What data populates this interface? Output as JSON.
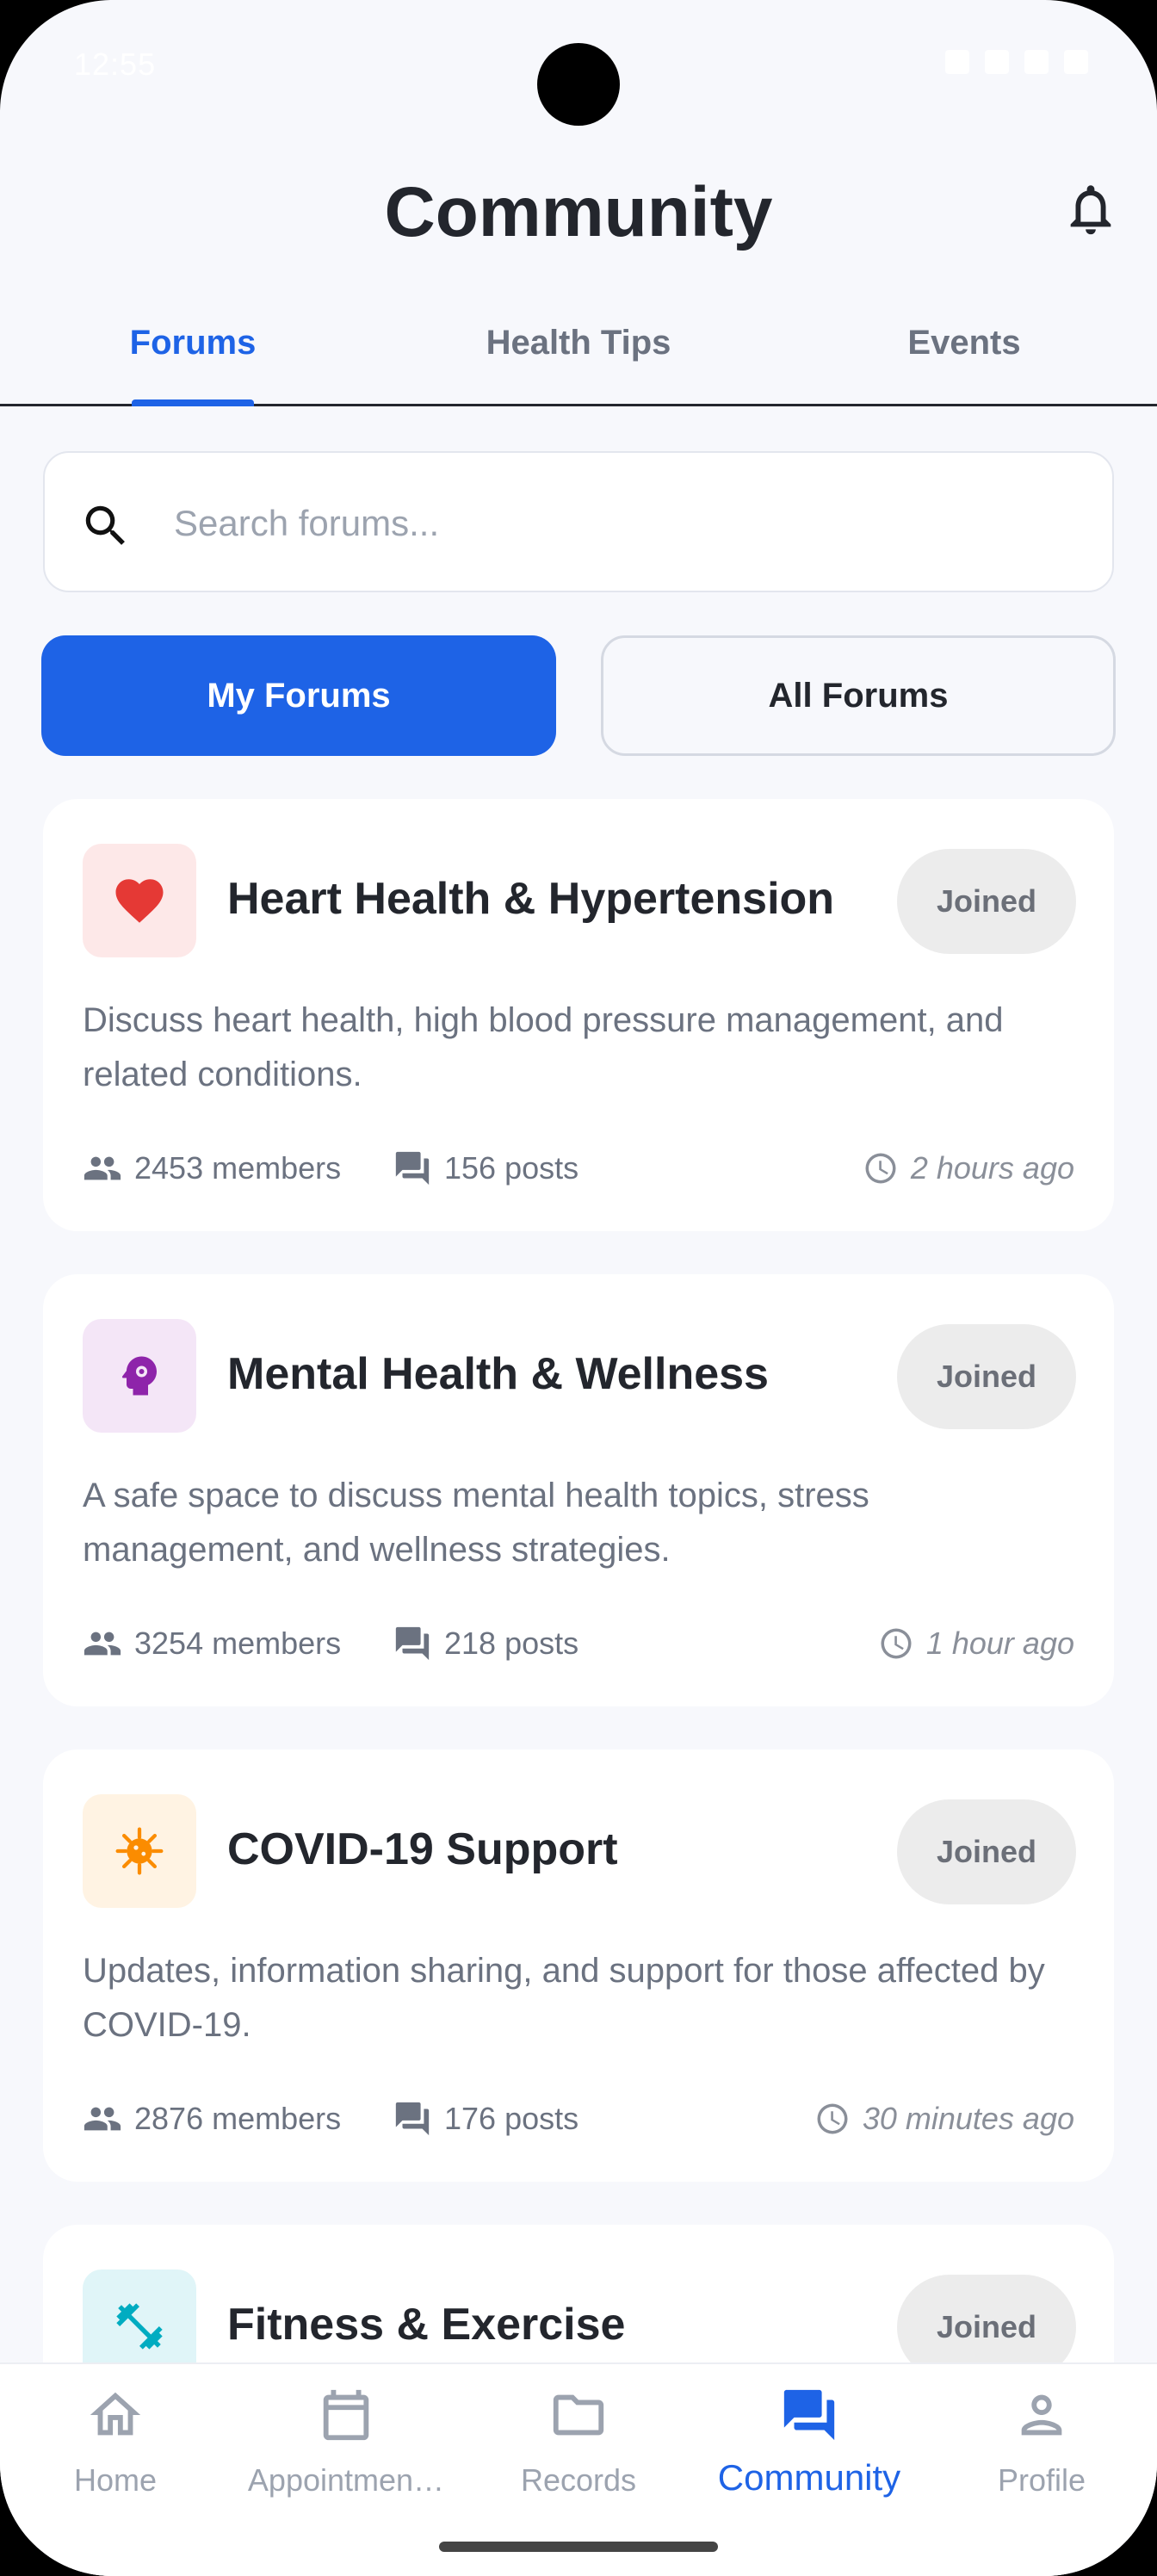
{
  "status_bar": {
    "time": "12:55"
  },
  "header": {
    "title": "Community"
  },
  "tabs": [
    {
      "label": "Forums",
      "active": true
    },
    {
      "label": "Health Tips",
      "active": false
    },
    {
      "label": "Events",
      "active": false
    }
  ],
  "search": {
    "placeholder": "Search forums..."
  },
  "segments": {
    "my_forums": "My Forums",
    "all_forums": "All Forums"
  },
  "forums": [
    {
      "icon": "heart-icon",
      "icon_color": "#e53935",
      "icon_bg": "#fde8e8",
      "title": "Heart Health & Hypertension",
      "status": "Joined",
      "description": "Discuss heart health, high blood pressure management, and related conditions.",
      "members": "2453 members",
      "posts": "156 posts",
      "last_active": "2 hours ago"
    },
    {
      "icon": "psychology-icon",
      "icon_color": "#8e24aa",
      "icon_bg": "#f4e6f7",
      "title": "Mental Health & Wellness",
      "status": "Joined",
      "description": "A safe space to discuss mental health topics, stress management, and wellness strategies.",
      "members": "3254 members",
      "posts": "218 posts",
      "last_active": "1 hour ago"
    },
    {
      "icon": "coronavirus-icon",
      "icon_color": "#fb8c00",
      "icon_bg": "#fff3e3",
      "title": "COVID-19 Support",
      "status": "Joined",
      "description": "Updates, information sharing, and support for those affected by COVID-19.",
      "members": "2876 members",
      "posts": "176 posts",
      "last_active": "30 minutes ago"
    },
    {
      "icon": "fitness-icon",
      "icon_color": "#00acc1",
      "icon_bg": "#e0f5f8",
      "title": "Fitness & Exercise",
      "status": "Joined"
    }
  ],
  "bottom_nav": [
    {
      "label": "Home",
      "icon": "home-icon"
    },
    {
      "label": "Appointmen…",
      "icon": "calendar-icon"
    },
    {
      "label": "Records",
      "icon": "folder-icon"
    },
    {
      "label": "Community",
      "icon": "forum-icon",
      "active": true
    },
    {
      "label": "Profile",
      "icon": "person-icon"
    }
  ],
  "colors": {
    "accent": "#1e63e6",
    "text": "#23262d",
    "muted": "#6b7280",
    "background": "#f7f8fc"
  }
}
